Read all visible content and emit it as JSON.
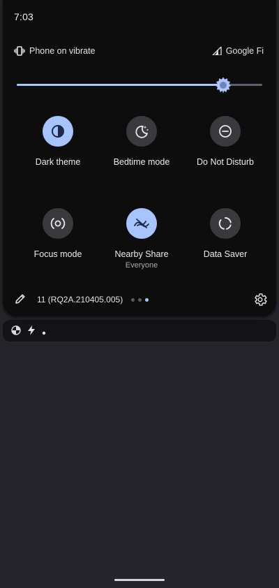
{
  "status_bar": {
    "time": "7:03"
  },
  "header": {
    "ringer_mode": "Phone on vibrate",
    "carrier": "Google Fi"
  },
  "brightness": {
    "level_fraction": 0.84
  },
  "tiles": [
    {
      "label": "Dark theme",
      "sublabel": "",
      "icon": "dark-theme-icon",
      "active": true
    },
    {
      "label": "Bedtime mode",
      "sublabel": "",
      "icon": "bedtime-moon-icon",
      "active": false
    },
    {
      "label": "Do Not Disturb",
      "sublabel": "",
      "icon": "do-not-disturb-icon",
      "active": false
    },
    {
      "label": "Focus mode",
      "sublabel": "",
      "icon": "focus-mode-icon",
      "active": false
    },
    {
      "label": "Nearby Share",
      "sublabel": "Everyone",
      "icon": "nearby-share-icon",
      "active": true
    },
    {
      "label": "Data Saver",
      "sublabel": "",
      "icon": "data-saver-icon",
      "active": false
    }
  ],
  "footer": {
    "build_number": "11 (RQ2A.210405.005)",
    "page_count": 3,
    "current_page": 3
  },
  "notifications": {
    "icons": [
      "app-notification-icon",
      "flash-icon",
      "more-dot-icon"
    ]
  },
  "colors": {
    "accent": "#a8c4ff",
    "tile_inactive": "#3a3a3e",
    "panel_bg": "#0d0d0d"
  }
}
